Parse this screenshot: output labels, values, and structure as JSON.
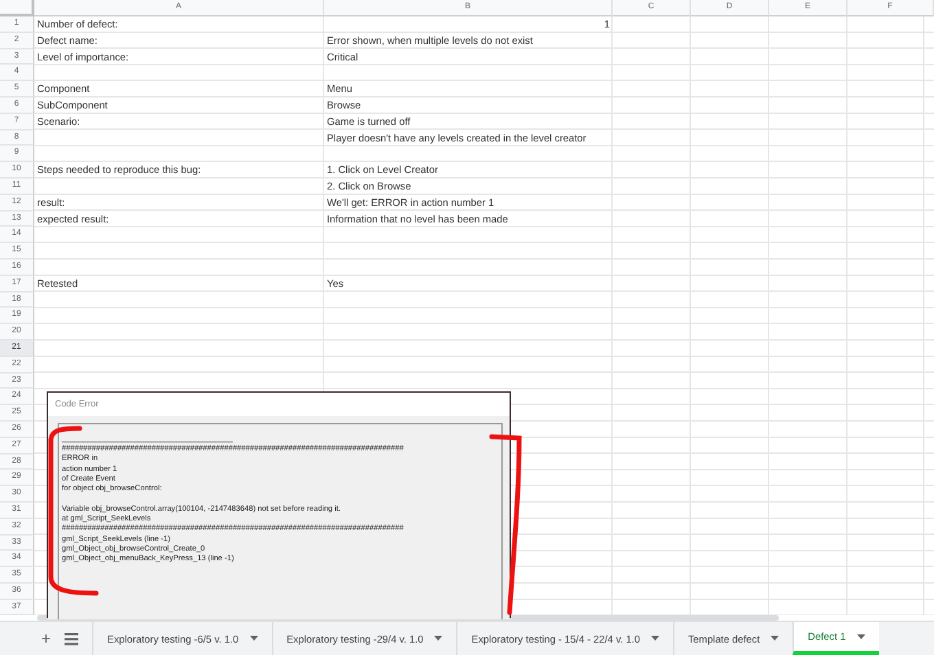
{
  "columns": [
    "A",
    "B",
    "C",
    "D",
    "E",
    "F"
  ],
  "rows": [
    {
      "number": "1",
      "a": "Number of defect:",
      "b": "1",
      "kind": "number",
      "selected": false
    },
    {
      "number": "2",
      "a": "Defect name:",
      "b": "Error shown, when multiple levels do not exist",
      "kind": "text",
      "selected": false
    },
    {
      "number": "3",
      "a": "Level of importance:",
      "b": "Critical",
      "kind": "text",
      "selected": false
    },
    {
      "number": "4",
      "kind": "text",
      "selected": false
    },
    {
      "number": "5",
      "a": "Component",
      "b": "Menu",
      "kind": "text",
      "selected": false
    },
    {
      "number": "6",
      "a": "SubComponent",
      "b": "Browse",
      "kind": "text",
      "selected": false
    },
    {
      "number": "7",
      "a": "Scenario:",
      "b": "Game is turned off",
      "kind": "text",
      "selected": false
    },
    {
      "number": "8",
      "b": "Player doesn't have any levels created in the level creator",
      "kind": "text",
      "selected": false
    },
    {
      "number": "9",
      "kind": "text",
      "selected": false
    },
    {
      "number": "10",
      "a": "Steps needed to reproduce this bug:",
      "b": "1. Click on Level Creator",
      "kind": "text",
      "selected": false
    },
    {
      "number": "11",
      "b": "2. Click on Browse",
      "kind": "text",
      "selected": false
    },
    {
      "number": "12",
      "a": "result:",
      "b": "We'll get: ERROR in action number 1",
      "kind": "text",
      "selected": false
    },
    {
      "number": "13",
      "a": "expected result:",
      "b": "Information that no level has been made",
      "kind": "text",
      "selected": false
    },
    {
      "number": "14",
      "kind": "text",
      "selected": false
    },
    {
      "number": "15",
      "kind": "text",
      "selected": false
    },
    {
      "number": "16",
      "kind": "text",
      "selected": false
    },
    {
      "number": "17",
      "a": "Retested",
      "b": "Yes",
      "kind": "text",
      "selected": false
    },
    {
      "number": "18",
      "kind": "text",
      "selected": false
    },
    {
      "number": "19",
      "kind": "text",
      "selected": false
    },
    {
      "number": "20",
      "kind": "text",
      "selected": false
    },
    {
      "number": "21",
      "kind": "text",
      "selected": true
    },
    {
      "number": "22",
      "kind": "text",
      "selected": false
    },
    {
      "number": "23",
      "kind": "text",
      "selected": false
    },
    {
      "number": "24",
      "kind": "text",
      "selected": false
    },
    {
      "number": "25",
      "kind": "text",
      "selected": false
    },
    {
      "number": "26",
      "kind": "text",
      "selected": false
    },
    {
      "number": "27",
      "kind": "text",
      "selected": false
    },
    {
      "number": "28",
      "kind": "text",
      "selected": false
    },
    {
      "number": "29",
      "kind": "text",
      "selected": false
    },
    {
      "number": "30",
      "kind": "text",
      "selected": false
    },
    {
      "number": "31",
      "kind": "text",
      "selected": false
    },
    {
      "number": "32",
      "kind": "text",
      "selected": false
    },
    {
      "number": "33",
      "kind": "text",
      "selected": false
    },
    {
      "number": "34",
      "kind": "text",
      "selected": false
    },
    {
      "number": "35",
      "kind": "text",
      "selected": false
    },
    {
      "number": "36",
      "kind": "text",
      "selected": false
    },
    {
      "number": "37",
      "kind": "text",
      "selected": false
    }
  ],
  "error_dialog": {
    "title": "Code Error",
    "paragraphs": [
      [
        "________________________________________",
        "################################################################################",
        "ERROR in",
        "action number 1",
        "of Create Event",
        "for object obj_browseControl:"
      ],
      [
        "Variable obj_browseControl.array(100104, -2147483648) not set before reading it.",
        "at gml_Script_SeekLevels",
        "################################################################################",
        "gml_Script_SeekLevels (line -1)",
        "gml_Object_obj_browseControl_Create_0",
        "gml_Object_obj_menuBack_KeyPress_13 (line -1)"
      ]
    ]
  },
  "sheet_bar": {
    "add": "+",
    "tabs": [
      {
        "label": "Exploratory testing -6/5 v. 1.0",
        "selected": false
      },
      {
        "label": "Exploratory testing -29/4 v. 1.0",
        "selected": false
      },
      {
        "label": "Exploratory testing - 15/4 - 22/4 v. 1.0",
        "selected": false
      },
      {
        "label": "Template defect",
        "selected": false
      },
      {
        "label": "Defect 1",
        "selected": true
      }
    ]
  }
}
